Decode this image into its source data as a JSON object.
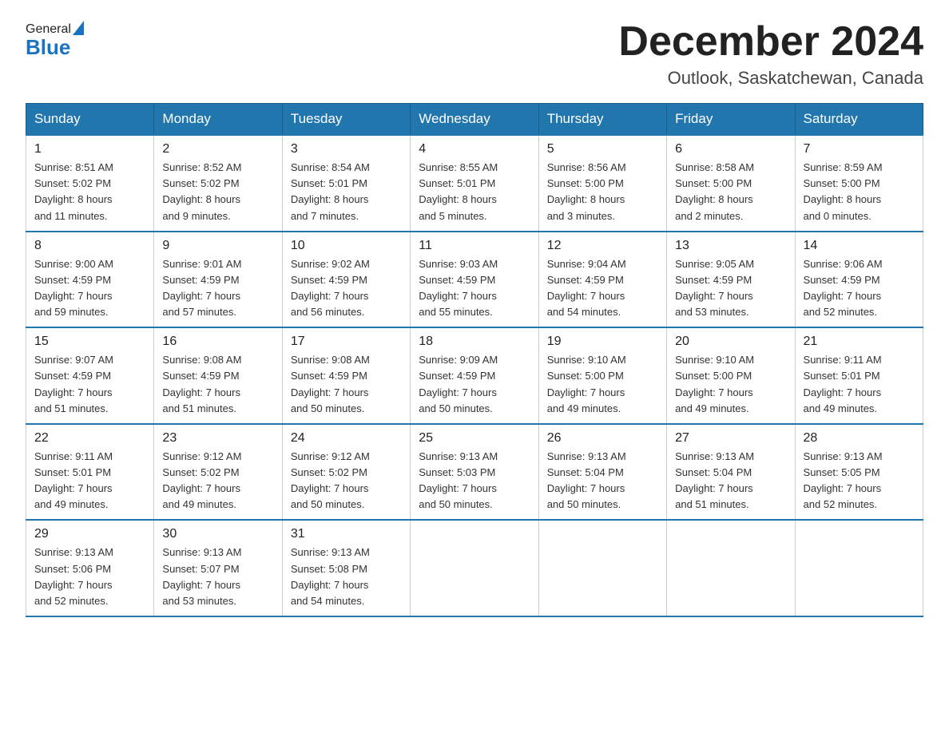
{
  "logo": {
    "general": "General",
    "blue": "Blue"
  },
  "header": {
    "month": "December 2024",
    "location": "Outlook, Saskatchewan, Canada"
  },
  "weekdays": [
    "Sunday",
    "Monday",
    "Tuesday",
    "Wednesday",
    "Thursday",
    "Friday",
    "Saturday"
  ],
  "weeks": [
    [
      {
        "day": "1",
        "sunrise": "8:51 AM",
        "sunset": "5:02 PM",
        "daylight": "8 hours and 11 minutes."
      },
      {
        "day": "2",
        "sunrise": "8:52 AM",
        "sunset": "5:02 PM",
        "daylight": "8 hours and 9 minutes."
      },
      {
        "day": "3",
        "sunrise": "8:54 AM",
        "sunset": "5:01 PM",
        "daylight": "8 hours and 7 minutes."
      },
      {
        "day": "4",
        "sunrise": "8:55 AM",
        "sunset": "5:01 PM",
        "daylight": "8 hours and 5 minutes."
      },
      {
        "day": "5",
        "sunrise": "8:56 AM",
        "sunset": "5:00 PM",
        "daylight": "8 hours and 3 minutes."
      },
      {
        "day": "6",
        "sunrise": "8:58 AM",
        "sunset": "5:00 PM",
        "daylight": "8 hours and 2 minutes."
      },
      {
        "day": "7",
        "sunrise": "8:59 AM",
        "sunset": "5:00 PM",
        "daylight": "8 hours and 0 minutes."
      }
    ],
    [
      {
        "day": "8",
        "sunrise": "9:00 AM",
        "sunset": "4:59 PM",
        "daylight": "7 hours and 59 minutes."
      },
      {
        "day": "9",
        "sunrise": "9:01 AM",
        "sunset": "4:59 PM",
        "daylight": "7 hours and 57 minutes."
      },
      {
        "day": "10",
        "sunrise": "9:02 AM",
        "sunset": "4:59 PM",
        "daylight": "7 hours and 56 minutes."
      },
      {
        "day": "11",
        "sunrise": "9:03 AM",
        "sunset": "4:59 PM",
        "daylight": "7 hours and 55 minutes."
      },
      {
        "day": "12",
        "sunrise": "9:04 AM",
        "sunset": "4:59 PM",
        "daylight": "7 hours and 54 minutes."
      },
      {
        "day": "13",
        "sunrise": "9:05 AM",
        "sunset": "4:59 PM",
        "daylight": "7 hours and 53 minutes."
      },
      {
        "day": "14",
        "sunrise": "9:06 AM",
        "sunset": "4:59 PM",
        "daylight": "7 hours and 52 minutes."
      }
    ],
    [
      {
        "day": "15",
        "sunrise": "9:07 AM",
        "sunset": "4:59 PM",
        "daylight": "7 hours and 51 minutes."
      },
      {
        "day": "16",
        "sunrise": "9:08 AM",
        "sunset": "4:59 PM",
        "daylight": "7 hours and 51 minutes."
      },
      {
        "day": "17",
        "sunrise": "9:08 AM",
        "sunset": "4:59 PM",
        "daylight": "7 hours and 50 minutes."
      },
      {
        "day": "18",
        "sunrise": "9:09 AM",
        "sunset": "4:59 PM",
        "daylight": "7 hours and 50 minutes."
      },
      {
        "day": "19",
        "sunrise": "9:10 AM",
        "sunset": "5:00 PM",
        "daylight": "7 hours and 49 minutes."
      },
      {
        "day": "20",
        "sunrise": "9:10 AM",
        "sunset": "5:00 PM",
        "daylight": "7 hours and 49 minutes."
      },
      {
        "day": "21",
        "sunrise": "9:11 AM",
        "sunset": "5:01 PM",
        "daylight": "7 hours and 49 minutes."
      }
    ],
    [
      {
        "day": "22",
        "sunrise": "9:11 AM",
        "sunset": "5:01 PM",
        "daylight": "7 hours and 49 minutes."
      },
      {
        "day": "23",
        "sunrise": "9:12 AM",
        "sunset": "5:02 PM",
        "daylight": "7 hours and 49 minutes."
      },
      {
        "day": "24",
        "sunrise": "9:12 AM",
        "sunset": "5:02 PM",
        "daylight": "7 hours and 50 minutes."
      },
      {
        "day": "25",
        "sunrise": "9:13 AM",
        "sunset": "5:03 PM",
        "daylight": "7 hours and 50 minutes."
      },
      {
        "day": "26",
        "sunrise": "9:13 AM",
        "sunset": "5:04 PM",
        "daylight": "7 hours and 50 minutes."
      },
      {
        "day": "27",
        "sunrise": "9:13 AM",
        "sunset": "5:04 PM",
        "daylight": "7 hours and 51 minutes."
      },
      {
        "day": "28",
        "sunrise": "9:13 AM",
        "sunset": "5:05 PM",
        "daylight": "7 hours and 52 minutes."
      }
    ],
    [
      {
        "day": "29",
        "sunrise": "9:13 AM",
        "sunset": "5:06 PM",
        "daylight": "7 hours and 52 minutes."
      },
      {
        "day": "30",
        "sunrise": "9:13 AM",
        "sunset": "5:07 PM",
        "daylight": "7 hours and 53 minutes."
      },
      {
        "day": "31",
        "sunrise": "9:13 AM",
        "sunset": "5:08 PM",
        "daylight": "7 hours and 54 minutes."
      },
      null,
      null,
      null,
      null
    ]
  ],
  "labels": {
    "sunrise": "Sunrise:",
    "sunset": "Sunset:",
    "daylight": "Daylight:"
  }
}
